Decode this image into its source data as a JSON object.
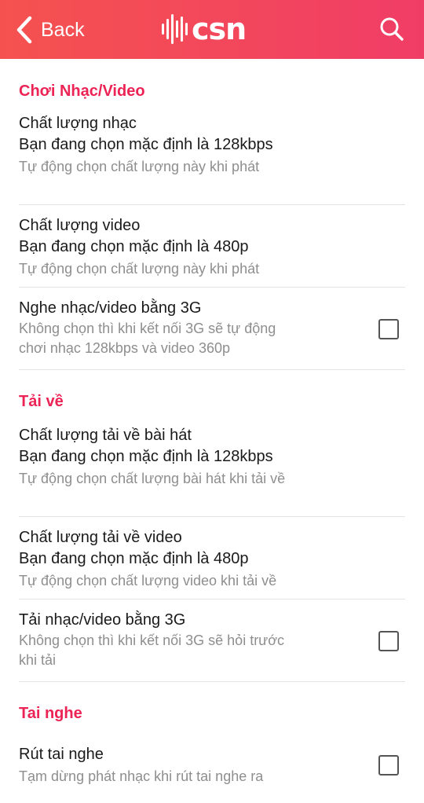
{
  "header": {
    "back_label": "Back",
    "logo_text": "csn",
    "accent_color": "#f3485b"
  },
  "sections": [
    {
      "title": "Chơi Nhạc/Video",
      "items": [
        {
          "title": "Chất lượng nhạc",
          "value": "Bạn đang chọn mặc định là 128kbps",
          "desc": "Tự động chọn chất lượng này khi phát"
        },
        {
          "title": "Chất lượng video",
          "value": "Bạn đang chọn mặc định là 480p",
          "desc": "Tự động chọn chất lượng này khi phát"
        },
        {
          "title": "Nghe nhạc/video bằng 3G",
          "desc_line1": "Không chọn thì khi kết nối 3G sẽ tự động",
          "desc_line2": "chơi nhạc 128kbps và video 360p",
          "checked": false
        }
      ]
    },
    {
      "title": "Tải về",
      "items": [
        {
          "title": "Chất lượng tải về bài hát",
          "value": "Bạn đang chọn mặc định là 128kbps",
          "desc": "Tự động chọn chất lượng bài hát khi tải về"
        },
        {
          "title": "Chất lượng tải về video",
          "value": "Bạn đang chọn mặc định là 480p",
          "desc": "Tự động chọn chất lượng video khi tải về"
        },
        {
          "title": "Tải nhạc/video bằng 3G",
          "desc_line1": "Không chọn thì khi kết nối 3G sẽ hỏi trước",
          "desc_line2": "khi tải",
          "checked": false
        }
      ]
    },
    {
      "title": "Tai nghe",
      "items": [
        {
          "title": "Rút tai nghe",
          "desc": "Tạm dừng phát nhạc khi rút tai nghe ra",
          "checked": false
        }
      ]
    }
  ]
}
